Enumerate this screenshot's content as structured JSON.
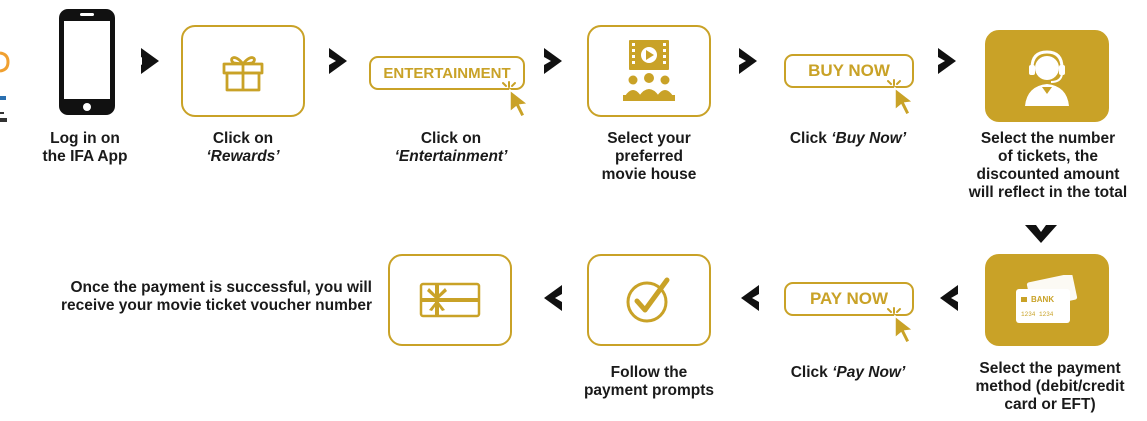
{
  "colors": {
    "gold": "#c9a227",
    "dark": "#1a1a1a"
  },
  "steps": [
    {
      "id": "login",
      "icon": "smartphone-icon",
      "label_line1": "Log in on",
      "label_line2": "the IFA App"
    },
    {
      "id": "rewards",
      "icon": "gift-box-icon",
      "label_plain": "Click on",
      "label_italic": "‘Rewards’"
    },
    {
      "id": "entertainment",
      "button_text": "ENTERTAINMENT",
      "icon": "cursor-click-icon",
      "label_plain": "Click on",
      "label_italic": "‘Entertainment’"
    },
    {
      "id": "movie-house",
      "icon": "cinema-audience-icon",
      "label_line1": "Select your",
      "label_line2": "preferred",
      "label_line3": "movie house"
    },
    {
      "id": "buy-now",
      "button_text": "BUY NOW",
      "icon": "cursor-click-icon",
      "label_plain": "Click",
      "label_italic": "‘Buy Now’"
    },
    {
      "id": "tickets",
      "icon": "call-center-agent-icon",
      "label_line1": "Select the number",
      "label_line2": "of tickets, the",
      "label_line3": "discounted amount",
      "label_line4": "will reflect in the total"
    },
    {
      "id": "payment-method",
      "icon": "bank-card-icon",
      "card_bank_text": "BANK",
      "card_number_text": "1234 1234",
      "label_line1": "Select the payment",
      "label_line2": "method (debit/credit",
      "label_line3": "card or EFT)"
    },
    {
      "id": "pay-now",
      "button_text": "PAY NOW",
      "icon": "cursor-click-icon",
      "label_plain": "Click",
      "label_italic": "‘Pay Now’"
    },
    {
      "id": "prompts",
      "icon": "checkmark-circle-icon",
      "label_line1": "Follow the",
      "label_line2": "payment prompts"
    },
    {
      "id": "voucher",
      "icon": "gift-voucher-icon",
      "label_line1": "Once the payment is successful, you will",
      "label_line2": "receive your movie ticket voucher number"
    }
  ]
}
